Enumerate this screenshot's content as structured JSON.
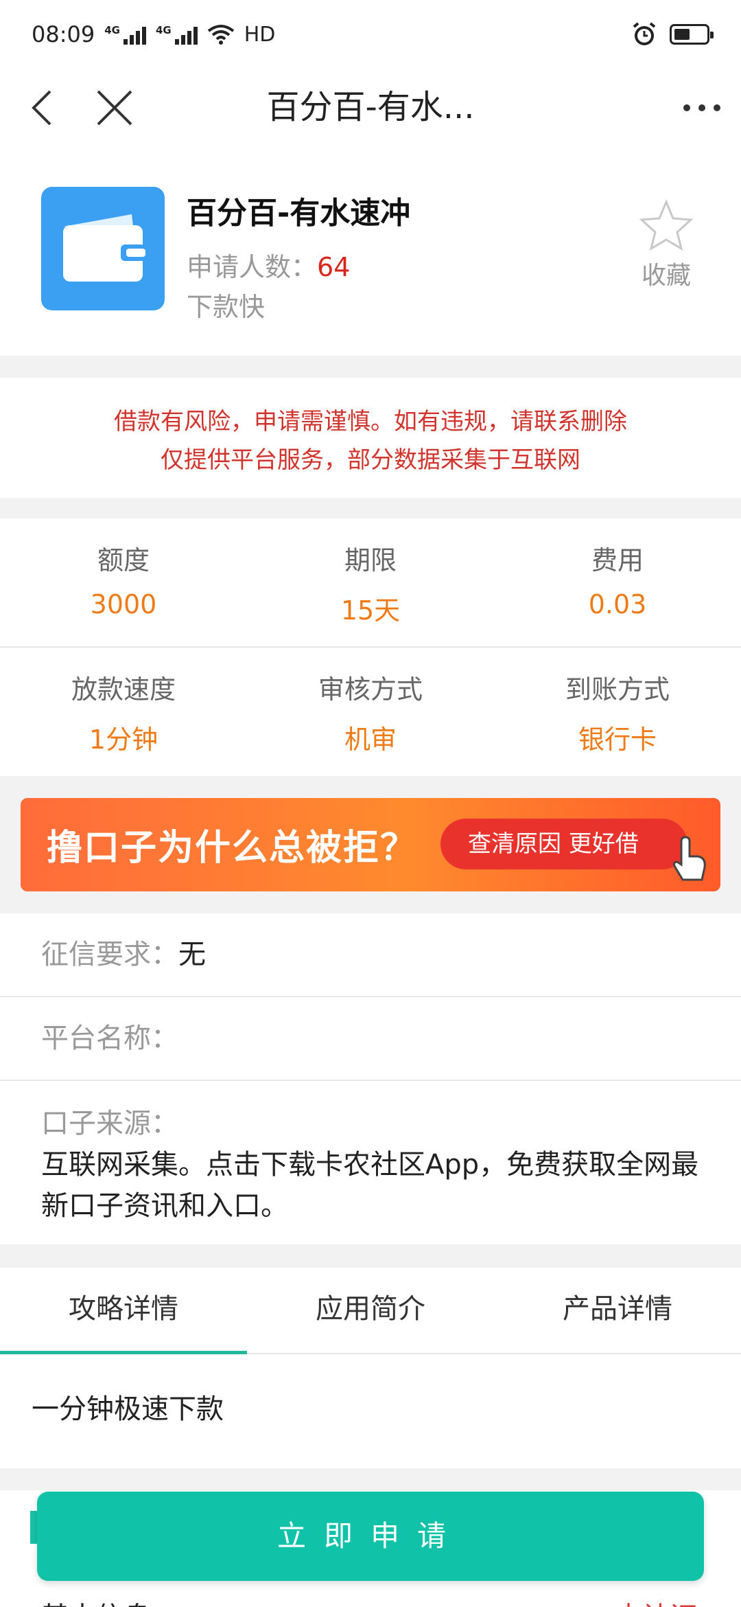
{
  "status_bar": {
    "time": "08:09",
    "signal1_tag": "4G",
    "signal2_tag": "4G",
    "hd_label": "HD",
    "icons": [
      "signal-icon",
      "wifi-icon",
      "alarm-icon",
      "battery-icon"
    ]
  },
  "nav": {
    "title": "百分百-有水...",
    "icons": [
      "back-icon",
      "close-icon",
      "more-icon"
    ]
  },
  "product": {
    "name": "百分百-有水速冲",
    "applicants_label": "申请人数：",
    "applicants_count": "64",
    "tag": "下款快",
    "favorite_label": "收藏",
    "icon_color": "#3ba0f2"
  },
  "warning": {
    "line1": "借款有风险，申请需谨慎。如有违规，请联系删除",
    "line2": "仅提供平台服务，部分数据采集于互联网"
  },
  "stats": {
    "row1": [
      {
        "label": "额度",
        "value": "3000"
      },
      {
        "label": "期限",
        "value": "15天"
      },
      {
        "label": "费用",
        "value": "0.03"
      }
    ],
    "row2": [
      {
        "label": "放款速度",
        "value": "1分钟"
      },
      {
        "label": "审核方式",
        "value": "机审"
      },
      {
        "label": "到账方式",
        "value": "银行卡"
      }
    ]
  },
  "banner": {
    "title": "撸口子为什么总被拒？",
    "pill": "查清原因 更好借"
  },
  "info": {
    "credit_label": "征信要求：",
    "credit_value": "无",
    "platform_label": "平台名称：",
    "platform_value": "",
    "source_label": "口子来源：",
    "source_value": "互联网采集。点击下载卡农社区App，免费获取全网最新口子资讯和入口。"
  },
  "tabs": [
    {
      "label": "攻略详情",
      "active": true
    },
    {
      "label": "应用简介",
      "active": false
    },
    {
      "label": "产品详情",
      "active": false
    }
  ],
  "tab_content": "一分钟极速下款",
  "basic": {
    "label": "基本信息",
    "link": "去认证"
  },
  "apply_button": "立即申请",
  "colors": {
    "accent": "#10c2a8",
    "value_orange": "#ef7b17",
    "warning_red": "#d0342c"
  }
}
